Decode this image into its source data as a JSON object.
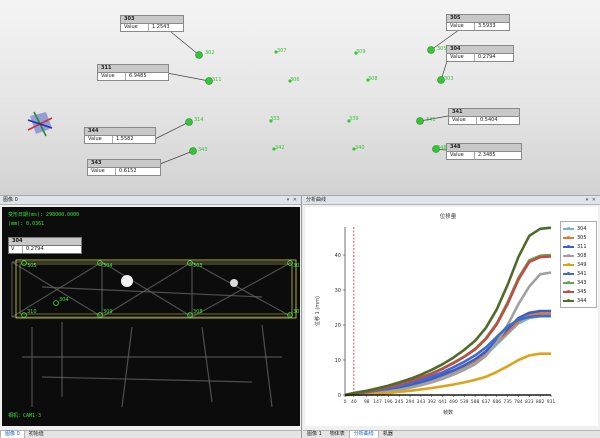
{
  "viewport": {
    "callouts": [
      {
        "id": "303",
        "title": "303",
        "label": "Value",
        "value": "1.2543"
      },
      {
        "id": "305",
        "title": "305",
        "label": "Value",
        "value": "3.5933"
      },
      {
        "id": "304",
        "title": "304",
        "label": "Value",
        "value": "0.2794"
      },
      {
        "id": "311",
        "title": "311",
        "label": "Value",
        "value": "6.9485"
      },
      {
        "id": "344",
        "title": "344",
        "label": "Value",
        "value": "1.5582"
      },
      {
        "id": "341",
        "title": "341",
        "label": "Value",
        "value": "0.5404"
      },
      {
        "id": "343",
        "title": "343",
        "label": "Value",
        "value": "0.6152"
      },
      {
        "id": "348",
        "title": "348",
        "label": "Value",
        "value": "2.3485"
      }
    ],
    "point_labels": [
      "302",
      "307",
      "309",
      "305",
      "311",
      "306",
      "308",
      "303",
      "314",
      "333",
      "339",
      "341",
      "343",
      "342",
      "340",
      "348"
    ]
  },
  "left_panel": {
    "title": "图像 0",
    "window_buttons": "▾ ✕",
    "overlay_line1": "变形日期(ms): 298000.0000",
    "overlay_line2": "(mm): 0.0361",
    "callout": {
      "title": "304",
      "label": "V",
      "value": "0.2794"
    },
    "img_points": [
      "305",
      "304",
      "303",
      "302",
      "310",
      "309",
      "308",
      "301",
      "304"
    ],
    "camera_label": "相机：CAM1-3",
    "tabs": [
      "图像 0",
      "初始值"
    ]
  },
  "right_panel": {
    "title": "分析曲线",
    "window_buttons": "▾ ✕",
    "tabs": [
      "图像 1",
      "物体表",
      "分析曲线",
      "机器"
    ]
  },
  "colors": {
    "accent": "#1a5fb4",
    "point_green": "#35c435",
    "overlay_green": "#3be03b"
  },
  "chart_data": {
    "type": "line",
    "title": "位移量",
    "xlabel": "帧数",
    "ylabel": "位移 1 (mm)",
    "xlim": [
      0,
      931
    ],
    "ylim": [
      0,
      48
    ],
    "x_ticks": [
      0,
      40,
      98,
      147,
      196,
      245,
      294,
      343,
      392,
      441,
      490,
      539,
      588,
      637,
      686,
      735,
      784,
      833,
      882,
      931
    ],
    "y_ticks": [
      0,
      10,
      20,
      30,
      40
    ],
    "marker_x": 40,
    "x": [
      0,
      40,
      98,
      147,
      196,
      245,
      294,
      343,
      392,
      441,
      490,
      539,
      588,
      637,
      686,
      735,
      784,
      833,
      882,
      931
    ],
    "series": [
      {
        "name": "304",
        "color": "#7bb1d6",
        "values": [
          0,
          0.2,
          0.5,
          0.9,
          1.4,
          2.0,
          2.8,
          3.5,
          4.3,
          5.4,
          6.5,
          7.8,
          9.4,
          11.5,
          14.5,
          17.5,
          20.5,
          22.0,
          22.5,
          22.5
        ]
      },
      {
        "name": "305",
        "color": "#e07a2c",
        "values": [
          0,
          0.2,
          0.5,
          0.9,
          1.4,
          2.0,
          2.8,
          3.6,
          4.5,
          5.6,
          6.8,
          8.2,
          9.8,
          12.0,
          15.0,
          18.0,
          21.0,
          22.8,
          23.3,
          23.3
        ]
      },
      {
        "name": "311",
        "color": "#3a5ecf",
        "values": [
          0,
          0.3,
          0.6,
          1.0,
          1.5,
          2.1,
          2.9,
          3.7,
          4.6,
          5.8,
          7.0,
          8.5,
          10.2,
          12.5,
          15.6,
          18.8,
          22.0,
          23.5,
          24.0,
          24.0
        ]
      },
      {
        "name": "308",
        "color": "#a0a0a0",
        "values": [
          0,
          0.1,
          0.3,
          0.6,
          1.0,
          1.5,
          2.1,
          2.8,
          3.6,
          4.6,
          5.8,
          7.2,
          8.8,
          11.2,
          15.0,
          20.0,
          26.0,
          31.0,
          34.5,
          35.0
        ]
      },
      {
        "name": "349",
        "color": "#d9a419",
        "values": [
          0,
          0.1,
          0.2,
          0.4,
          0.6,
          0.9,
          1.2,
          1.6,
          2.0,
          2.5,
          3.0,
          3.6,
          4.3,
          5.2,
          6.6,
          8.2,
          10.0,
          11.3,
          11.8,
          11.8
        ]
      },
      {
        "name": "341",
        "color": "#3f6cc7",
        "values": [
          0,
          0.4,
          0.8,
          1.3,
          1.9,
          2.6,
          3.4,
          4.3,
          5.3,
          6.5,
          7.9,
          9.5,
          11.3,
          13.6,
          16.6,
          19.6,
          21.5,
          22.3,
          22.6,
          22.6
        ]
      },
      {
        "name": "343",
        "color": "#5fa84a",
        "values": [
          0,
          0.5,
          1.0,
          1.6,
          2.3,
          3.1,
          4.0,
          5.0,
          6.2,
          7.6,
          9.2,
          11.0,
          13.2,
          16.2,
          20.5,
          26.5,
          33.5,
          38.5,
          39.8,
          40.0
        ]
      },
      {
        "name": "345",
        "color": "#c14a4a",
        "values": [
          0,
          0.5,
          1.0,
          1.6,
          2.3,
          3.1,
          4.0,
          5.0,
          6.1,
          7.5,
          9.1,
          10.9,
          13.0,
          16.0,
          20.2,
          26.0,
          33.0,
          38.0,
          39.4,
          39.6
        ]
      },
      {
        "name": "344",
        "color": "#4d6b2a",
        "values": [
          0,
          0.6,
          1.2,
          1.9,
          2.7,
          3.6,
          4.6,
          5.8,
          7.2,
          8.8,
          10.7,
          12.9,
          15.5,
          19.2,
          24.5,
          31.5,
          39.5,
          45.5,
          47.5,
          47.8
        ]
      },
      {
        "name": "",
        "color": "#1a1a1a",
        "values": [
          0,
          0,
          0,
          0,
          0,
          0,
          0,
          0,
          0,
          0,
          0,
          0,
          0,
          0,
          0,
          0,
          0,
          0,
          0,
          0
        ]
      }
    ],
    "grid": false,
    "legend": "right"
  }
}
